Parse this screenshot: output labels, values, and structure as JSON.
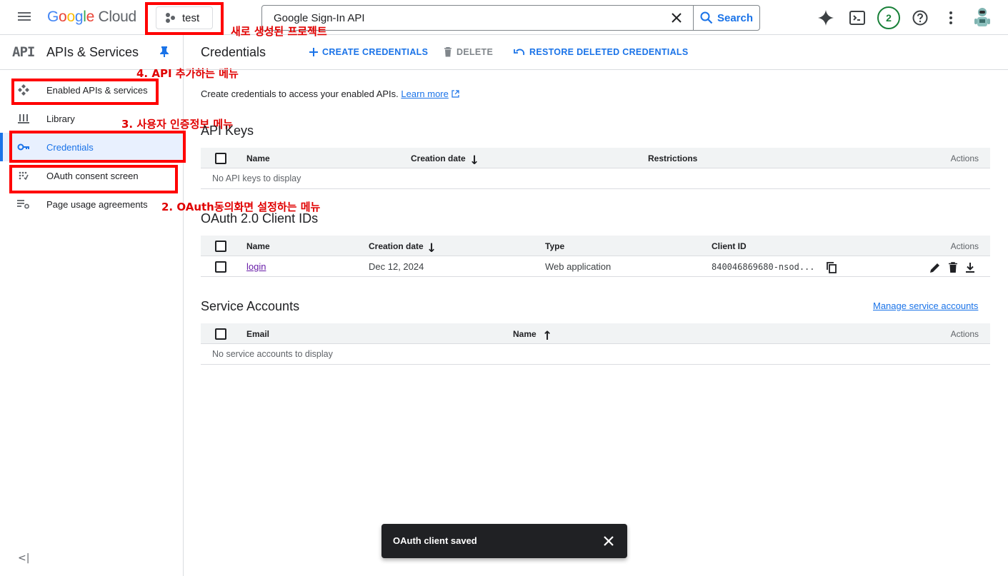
{
  "header": {
    "logo_google": "Google",
    "logo_cloud": "Cloud",
    "project_name": "test",
    "search": {
      "value": "Google Sign-In API",
      "button_label": "Search"
    },
    "notifications_count": "2"
  },
  "annotations": {
    "project": "새로 생성된 프로젝트",
    "enabled_apis": "4. API 추가하는 메뉴",
    "credentials": "3. 사용자 인증정보 메뉴",
    "oauth": "2. OAuth동의화면 설정하는 메뉴",
    "color": "#ff0000"
  },
  "sidebar": {
    "api_glyph": "API",
    "title": "APIs & Services",
    "items": [
      {
        "label": "Enabled APIs & services",
        "icon": "enabled-apis-icon"
      },
      {
        "label": "Library",
        "icon": "library-icon"
      },
      {
        "label": "Credentials",
        "icon": "key-icon",
        "active": true
      },
      {
        "label": "OAuth consent screen",
        "icon": "oauth-consent-icon"
      },
      {
        "label": "Page usage agreements",
        "icon": "page-usage-icon"
      }
    ],
    "collapse_label": "<|"
  },
  "main": {
    "title": "Credentials",
    "actions": {
      "create": "CREATE CREDENTIALS",
      "delete": "DELETE",
      "restore": "RESTORE DELETED CREDENTIALS"
    },
    "intro": "Create credentials to access your enabled APIs.",
    "learn_more": "Learn more",
    "api_keys": {
      "title": "API Keys",
      "columns": [
        "Name",
        "Creation date",
        "Restrictions",
        "Actions"
      ],
      "empty": "No API keys to display"
    },
    "oauth_clients": {
      "title": "OAuth 2.0 Client IDs",
      "columns": [
        "Name",
        "Creation date",
        "Type",
        "Client ID",
        "Actions"
      ],
      "rows": [
        {
          "name": "login",
          "date": "Dec 12, 2024",
          "type": "Web application",
          "client_id": "840046869680-nsod..."
        }
      ]
    },
    "service_accounts": {
      "title": "Service Accounts",
      "manage_link": "Manage service accounts",
      "columns": [
        "Email",
        "Name",
        "Actions"
      ],
      "empty": "No service accounts to display"
    }
  },
  "snackbar": {
    "message": "OAuth client saved"
  },
  "colors": {
    "accent": "#1a73e8",
    "active_bg": "#e8f0fe",
    "border": "#dadce0",
    "snackbar_bg": "#202124",
    "badge": "#188038"
  }
}
